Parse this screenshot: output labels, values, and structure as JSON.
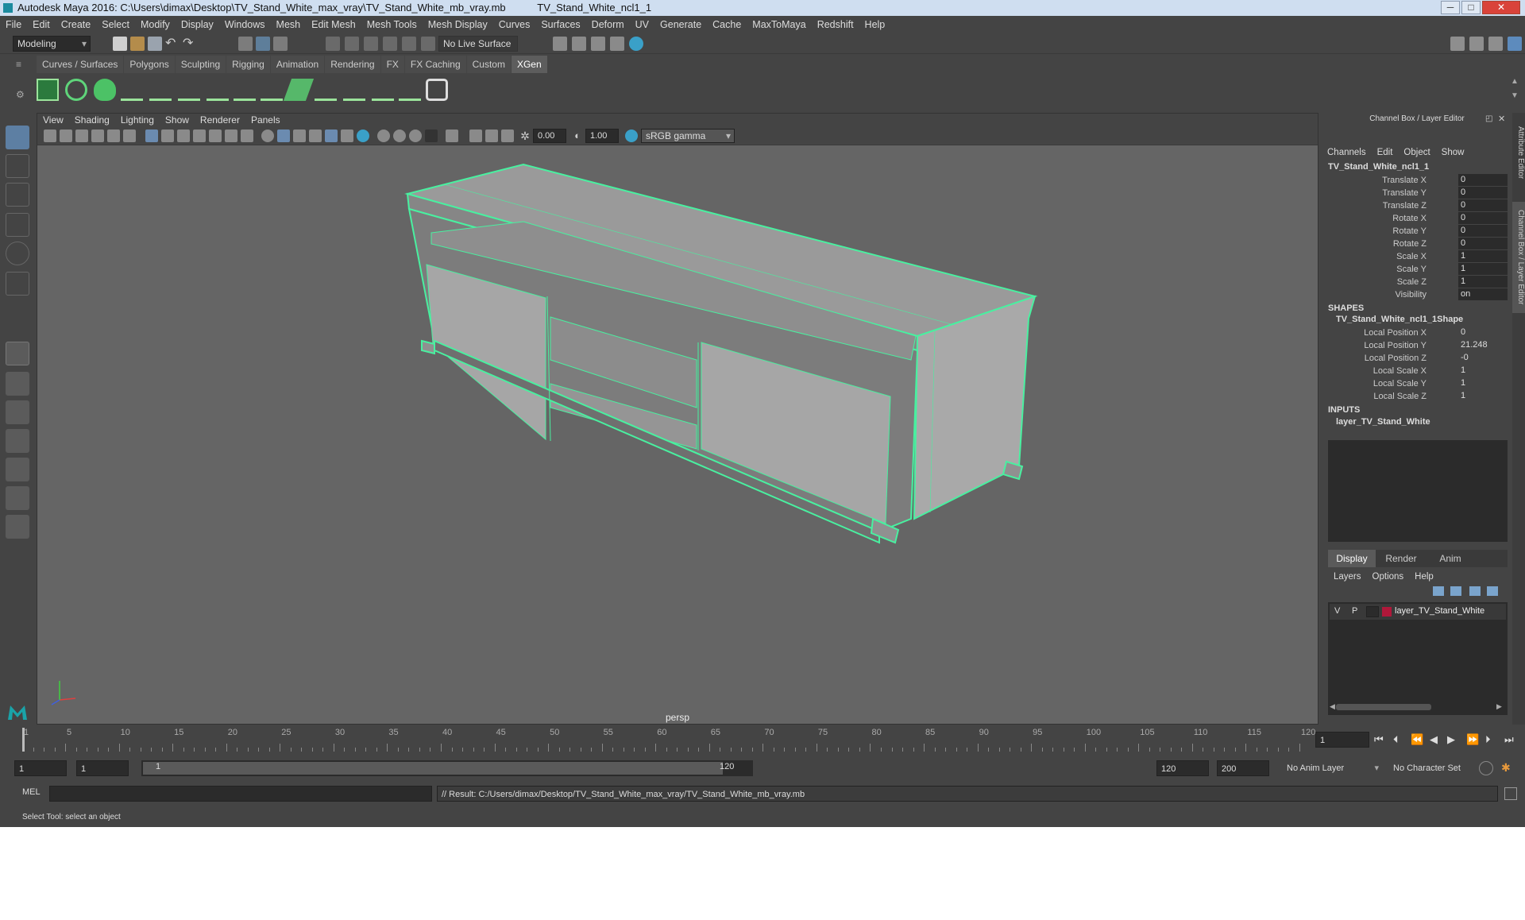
{
  "window": {
    "title": "Autodesk Maya 2016: C:\\Users\\dimax\\Desktop\\TV_Stand_White_max_vray\\TV_Stand_White_mb_vray.mb",
    "object": "TV_Stand_White_ncl1_1",
    "min": "─",
    "max": "□",
    "close": "✕"
  },
  "menu": [
    "File",
    "Edit",
    "Create",
    "Select",
    "Modify",
    "Display",
    "Windows",
    "Mesh",
    "Edit Mesh",
    "Mesh Tools",
    "Mesh Display",
    "Curves",
    "Surfaces",
    "Deform",
    "UV",
    "Generate",
    "Cache",
    "MaxToMaya",
    "Redshift",
    "Help"
  ],
  "status": {
    "mode": "Modeling",
    "live_surface": "No Live Surface"
  },
  "shelf_tabs": [
    "Curves / Surfaces",
    "Polygons",
    "Sculpting",
    "Rigging",
    "Animation",
    "Rendering",
    "FX",
    "FX Caching",
    "Custom",
    "XGen"
  ],
  "active_shelf": "XGen",
  "viewport": {
    "menu": [
      "View",
      "Shading",
      "Lighting",
      "Show",
      "Renderer",
      "Panels"
    ],
    "exposure": "0.00",
    "gamma": "1.00",
    "color_space": "sRGB gamma",
    "camera": "persp"
  },
  "channel_box": {
    "title": "Channel Box / Layer Editor",
    "menu": [
      "Channels",
      "Edit",
      "Object",
      "Show"
    ],
    "object": "TV_Stand_White_ncl1_1",
    "channels": [
      {
        "label": "Translate X",
        "value": "0"
      },
      {
        "label": "Translate Y",
        "value": "0"
      },
      {
        "label": "Translate Z",
        "value": "0"
      },
      {
        "label": "Rotate X",
        "value": "0"
      },
      {
        "label": "Rotate Y",
        "value": "0"
      },
      {
        "label": "Rotate Z",
        "value": "0"
      },
      {
        "label": "Scale X",
        "value": "1"
      },
      {
        "label": "Scale Y",
        "value": "1"
      },
      {
        "label": "Scale Z",
        "value": "1"
      },
      {
        "label": "Visibility",
        "value": "on"
      }
    ],
    "shapes_header": "SHAPES",
    "shape_name": "TV_Stand_White_ncl1_1Shape",
    "shape_channels": [
      {
        "label": "Local Position X",
        "value": "0"
      },
      {
        "label": "Local Position Y",
        "value": "21.248"
      },
      {
        "label": "Local Position Z",
        "value": "-0"
      },
      {
        "label": "Local Scale X",
        "value": "1"
      },
      {
        "label": "Local Scale Y",
        "value": "1"
      },
      {
        "label": "Local Scale Z",
        "value": "1"
      }
    ],
    "inputs_header": "INPUTS",
    "input_name": "layer_TV_Stand_White"
  },
  "layer_editor": {
    "tabs": [
      "Display",
      "Render",
      "Anim"
    ],
    "menu": [
      "Layers",
      "Options",
      "Help"
    ],
    "layer": {
      "v": "V",
      "p": "P",
      "name": "layer_TV_Stand_White",
      "color": "#b0183a"
    }
  },
  "side_tabs": [
    "Attribute Editor",
    "Channel Box / Layer Editor"
  ],
  "timeline": {
    "ticks": [
      "1",
      "5",
      "10",
      "15",
      "20",
      "25",
      "30",
      "35",
      "40",
      "45",
      "50",
      "55",
      "60",
      "65",
      "70",
      "75",
      "80",
      "85",
      "90",
      "95",
      "100",
      "105",
      "110",
      "115",
      "120"
    ],
    "current_frame": "1"
  },
  "range": {
    "start": "1",
    "anim_start": "1",
    "slider_start": "1",
    "slider_end": "120",
    "anim_end": "120",
    "end": "200",
    "anim_layer": "No Anim Layer",
    "character_set": "No Character Set"
  },
  "command": {
    "lang": "MEL",
    "result": "// Result: C:/Users/dimax/Desktop/TV_Stand_White_max_vray/TV_Stand_White_mb_vray.mb"
  },
  "help_line": "Select Tool: select an object",
  "colors": {
    "wire": "#49f0a0",
    "bg": "#444444",
    "viewport": "#656565"
  }
}
